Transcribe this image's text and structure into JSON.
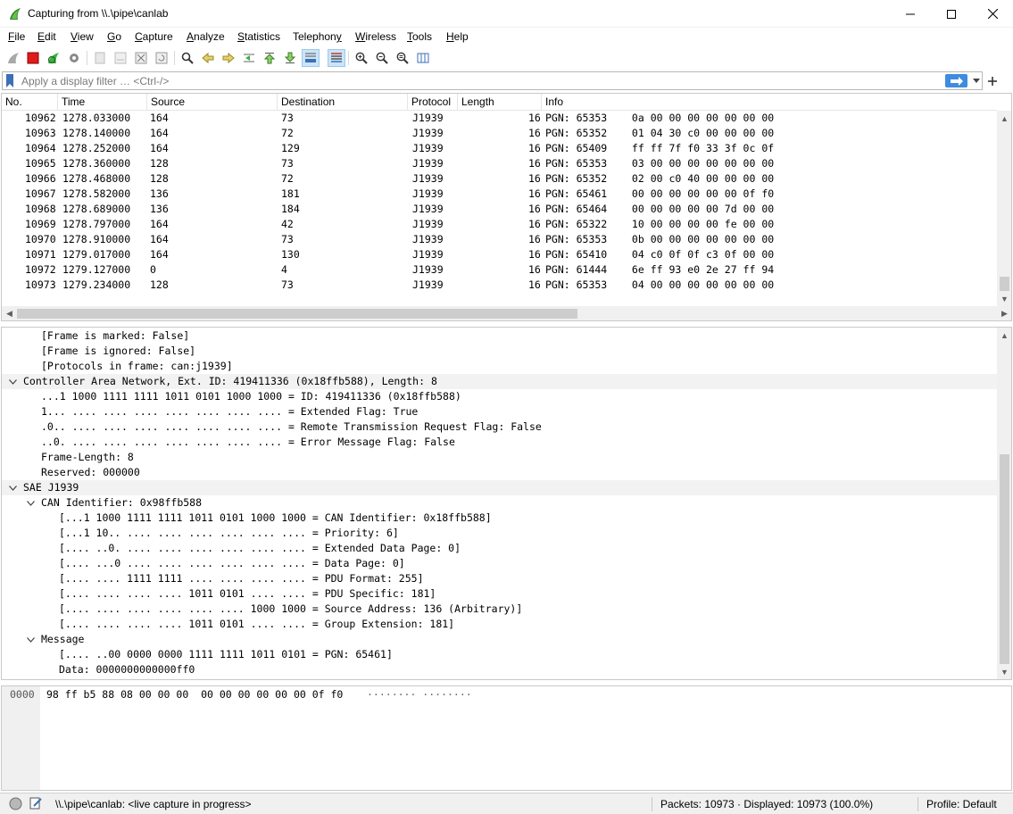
{
  "window": {
    "title": "Capturing from \\\\.\\pipe\\canlab",
    "minimize_icon": "minimize-icon",
    "maximize_icon": "maximize-icon",
    "close_icon": "close-icon"
  },
  "menu": [
    {
      "label": "File",
      "u": "F",
      "rest": "ile"
    },
    {
      "label": "Edit",
      "u": "E",
      "rest": "dit"
    },
    {
      "label": "View",
      "u": "V",
      "rest": "iew"
    },
    {
      "label": "Go",
      "u": "G",
      "rest": "o"
    },
    {
      "label": "Capture",
      "u": "C",
      "rest": "apture"
    },
    {
      "label": "Analyze",
      "u": "A",
      "rest": "nalyze"
    },
    {
      "label": "Statistics",
      "u": "S",
      "rest": "tatistics"
    },
    {
      "label": "Telephony",
      "u": "Telephon",
      "rest": "y",
      "u_last": true
    },
    {
      "label": "Wireless",
      "u": "W",
      "rest": "ireless"
    },
    {
      "label": "Tools",
      "u": "T",
      "rest": "ools"
    },
    {
      "label": "Help",
      "u": "H",
      "rest": "elp"
    }
  ],
  "filter": {
    "placeholder": "Apply a display filter … <Ctrl-/>",
    "value": ""
  },
  "packet_list": {
    "columns": [
      "No.",
      "Time",
      "Source",
      "Destination",
      "Protocol",
      "Length",
      "Info"
    ],
    "rows": [
      {
        "no": "10962",
        "time": "1278.033000",
        "src": "164",
        "dst": "73",
        "proto": "J1939",
        "len": "16",
        "info": "PGN: 65353    0a 00 00 00 00 00 00 00"
      },
      {
        "no": "10963",
        "time": "1278.140000",
        "src": "164",
        "dst": "72",
        "proto": "J1939",
        "len": "16",
        "info": "PGN: 65352    01 04 30 c0 00 00 00 00"
      },
      {
        "no": "10964",
        "time": "1278.252000",
        "src": "164",
        "dst": "129",
        "proto": "J1939",
        "len": "16",
        "info": "PGN: 65409    ff ff 7f f0 33 3f 0c 0f"
      },
      {
        "no": "10965",
        "time": "1278.360000",
        "src": "128",
        "dst": "73",
        "proto": "J1939",
        "len": "16",
        "info": "PGN: 65353    03 00 00 00 00 00 00 00"
      },
      {
        "no": "10966",
        "time": "1278.468000",
        "src": "128",
        "dst": "72",
        "proto": "J1939",
        "len": "16",
        "info": "PGN: 65352    02 00 c0 40 00 00 00 00"
      },
      {
        "no": "10967",
        "time": "1278.582000",
        "src": "136",
        "dst": "181",
        "proto": "J1939",
        "len": "16",
        "info": "PGN: 65461    00 00 00 00 00 00 0f f0"
      },
      {
        "no": "10968",
        "time": "1278.689000",
        "src": "136",
        "dst": "184",
        "proto": "J1939",
        "len": "16",
        "info": "PGN: 65464    00 00 00 00 00 7d 00 00"
      },
      {
        "no": "10969",
        "time": "1278.797000",
        "src": "164",
        "dst": "42",
        "proto": "J1939",
        "len": "16",
        "info": "PGN: 65322    10 00 00 00 00 fe 00 00"
      },
      {
        "no": "10970",
        "time": "1278.910000",
        "src": "164",
        "dst": "73",
        "proto": "J1939",
        "len": "16",
        "info": "PGN: 65353    0b 00 00 00 00 00 00 00"
      },
      {
        "no": "10971",
        "time": "1279.017000",
        "src": "164",
        "dst": "130",
        "proto": "J1939",
        "len": "16",
        "info": "PGN: 65410    04 c0 0f 0f c3 0f 00 00"
      },
      {
        "no": "10972",
        "time": "1279.127000",
        "src": "0",
        "dst": "4",
        "proto": "J1939",
        "len": "16",
        "info": "PGN: 61444    6e ff 93 e0 2e 27 ff 94"
      },
      {
        "no": "10973",
        "time": "1279.234000",
        "src": "128",
        "dst": "73",
        "proto": "J1939",
        "len": "16",
        "info": "PGN: 65353    04 00 00 00 00 00 00 00"
      }
    ]
  },
  "details": [
    {
      "indent": 1,
      "expander": "",
      "text": "[Frame is marked: False]"
    },
    {
      "indent": 1,
      "expander": "",
      "text": "[Frame is ignored: False]"
    },
    {
      "indent": 1,
      "expander": "",
      "text": "[Protocols in frame: can:j1939]"
    },
    {
      "indent": 0,
      "expander": "open",
      "text": "Controller Area Network, Ext. ID: 419411336 (0x18ffb588), Length: 8",
      "hl": true
    },
    {
      "indent": 1,
      "expander": "",
      "text": "...1 1000 1111 1111 1011 0101 1000 1000 = ID: 419411336 (0x18ffb588)"
    },
    {
      "indent": 1,
      "expander": "",
      "text": "1... .... .... .... .... .... .... .... = Extended Flag: True"
    },
    {
      "indent": 1,
      "expander": "",
      "text": ".0.. .... .... .... .... .... .... .... = Remote Transmission Request Flag: False"
    },
    {
      "indent": 1,
      "expander": "",
      "text": "..0. .... .... .... .... .... .... .... = Error Message Flag: False"
    },
    {
      "indent": 1,
      "expander": "",
      "text": "Frame-Length: 8"
    },
    {
      "indent": 1,
      "expander": "",
      "text": "Reserved: 000000"
    },
    {
      "indent": 0,
      "expander": "open",
      "text": "SAE J1939",
      "hl": true
    },
    {
      "indent": 1,
      "expander": "open",
      "text": "CAN Identifier: 0x98ffb588"
    },
    {
      "indent": 2,
      "expander": "",
      "text": "[...1 1000 1111 1111 1011 0101 1000 1000 = CAN Identifier: 0x18ffb588]"
    },
    {
      "indent": 2,
      "expander": "",
      "text": "[...1 10.. .... .... .... .... .... .... = Priority: 6]"
    },
    {
      "indent": 2,
      "expander": "",
      "text": "[.... ..0. .... .... .... .... .... .... = Extended Data Page: 0]"
    },
    {
      "indent": 2,
      "expander": "",
      "text": "[.... ...0 .... .... .... .... .... .... = Data Page: 0]"
    },
    {
      "indent": 2,
      "expander": "",
      "text": "[.... .... 1111 1111 .... .... .... .... = PDU Format: 255]"
    },
    {
      "indent": 2,
      "expander": "",
      "text": "[.... .... .... .... 1011 0101 .... .... = PDU Specific: 181]"
    },
    {
      "indent": 2,
      "expander": "",
      "text": "[.... .... .... .... .... .... 1000 1000 = Source Address: 136 (Arbitrary)]"
    },
    {
      "indent": 2,
      "expander": "",
      "text": "[.... .... .... .... 1011 0101 .... .... = Group Extension: 181]"
    },
    {
      "indent": 1,
      "expander": "open",
      "text": "Message"
    },
    {
      "indent": 2,
      "expander": "",
      "text": "[.... ..00 0000 0000 1111 1111 1011 0101 = PGN: 65461]"
    },
    {
      "indent": 2,
      "expander": "",
      "text": "Data: 0000000000000ff0"
    }
  ],
  "bytes": {
    "offset": "0000",
    "hex": "98 ff b5 88 08 00 00 00  00 00 00 00 00 00 0f f0",
    "ascii": "········ ········"
  },
  "status": {
    "capture_text": "\\\\.\\pipe\\canlab: <live capture in progress>",
    "packets_text": "Packets: 10973 · Displayed: 10973 (100.0%)",
    "profile_text": "Profile: Default"
  },
  "colors": {
    "accent_blue": "#3d8ce0",
    "pressed_bg": "#cce4f7",
    "stop_red": "#e01b1b",
    "shark_green": "#3cb043"
  }
}
